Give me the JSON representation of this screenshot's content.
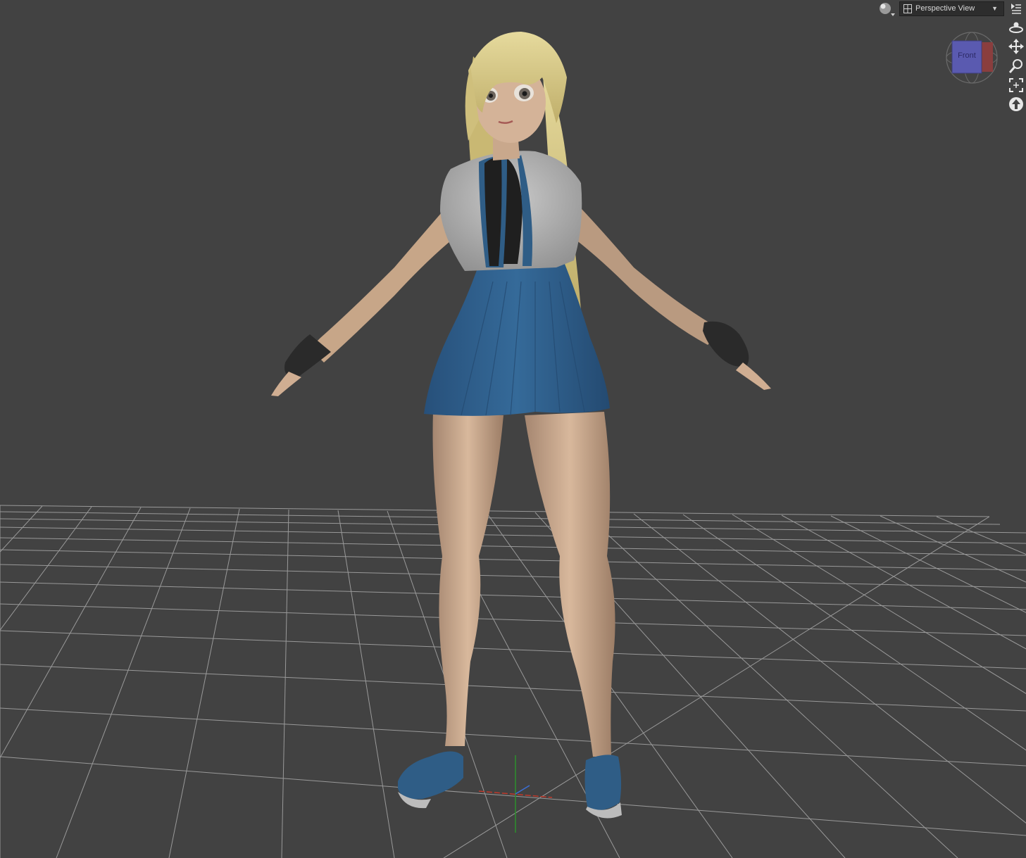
{
  "viewport": {
    "view_select": {
      "label": "Perspective View",
      "arrow": "▼"
    },
    "view_cube": {
      "face_label": "Front"
    },
    "toolbar_icons": [
      "shading-sphere-icon",
      "camera-icon",
      "pane-menu-icon",
      "orbit-icon",
      "pan-icon",
      "zoom-icon",
      "frame-icon",
      "aim-icon"
    ],
    "colors": {
      "background": "#424242",
      "grid": "#a9a9a9",
      "axis_x": "#c0392b",
      "axis_z": "#2d8f2d",
      "skirt": "#2f5d86",
      "hair": "#dccf8a",
      "skin": "#c9a88c"
    }
  }
}
